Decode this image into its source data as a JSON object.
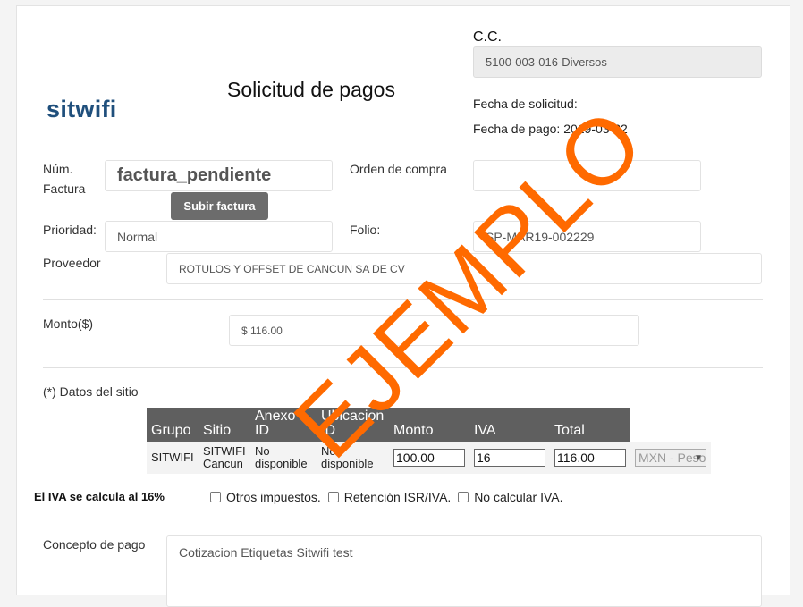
{
  "header": {
    "logo_text": "sitwifi",
    "title": "Solicitud de pagos",
    "cc_label": "C.C.",
    "cc_value": "5100-003-016-Diversos",
    "fecha_solicitud_label": "Fecha de solicitud:",
    "fecha_pago_label": "Fecha de pago:",
    "fecha_pago_value": "2019-03-22"
  },
  "form": {
    "num_factura_label_1": "Núm.",
    "num_factura_label_2": "Factura",
    "factura_value": "factura_pendiente",
    "subir_factura_button": "Subir factura",
    "orden_compra_label": "Orden de compra",
    "orden_compra_value": "",
    "prioridad_label": "Prioridad:",
    "prioridad_value": "Normal",
    "folio_label": "Folio:",
    "folio_value": "SP-MAR19-002229",
    "proveedor_label": "Proveedor",
    "proveedor_value": "ROTULOS Y OFFSET DE CANCUN SA DE CV",
    "monto_label": "Monto($)",
    "monto_value": "$ 116.00"
  },
  "sitio": {
    "section_label": "(*) Datos del sitio",
    "columns": [
      "Grupo",
      "Sitio",
      "Anexo ID",
      "Ubicacion ID",
      "Monto",
      "IVA",
      "Total"
    ],
    "rows": [
      {
        "grupo": "SITWIFI",
        "sitio": "SITWIFI Cancun",
        "anexo": "No disponible",
        "ubicacion": "No disponible",
        "monto": "100.00",
        "iva": "16",
        "total": "116.00",
        "moneda": "MXN - Peso"
      }
    ]
  },
  "iva": {
    "note": "El IVA se calcula al 16%",
    "otros": "Otros impuestos.",
    "retencion": "Retención ISR/IVA.",
    "no_calcular": "No calcular IVA."
  },
  "concepto": {
    "label": "Concepto de pago",
    "value": "Cotizacion Etiquetas Sitwifi test"
  },
  "watermark": "EJEMPLO"
}
